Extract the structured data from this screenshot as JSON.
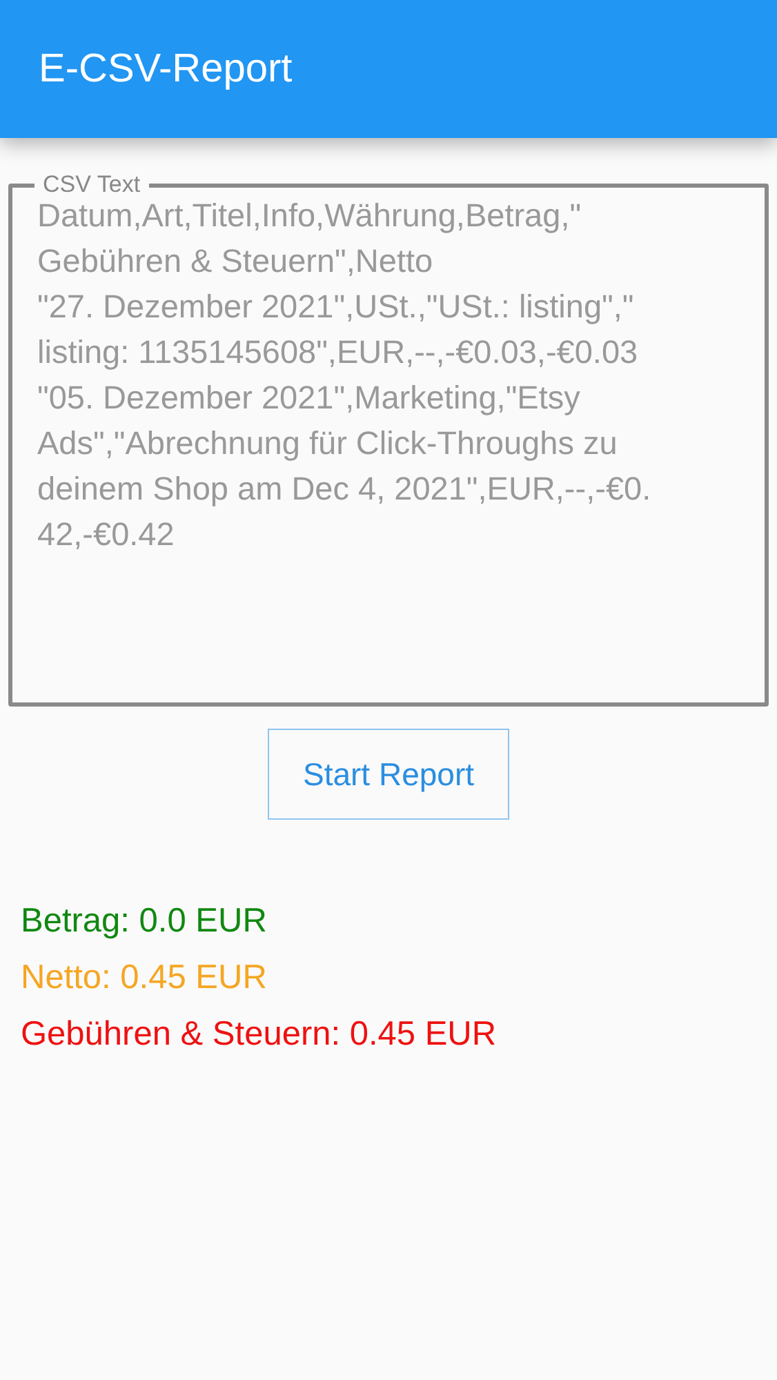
{
  "app_bar": {
    "title": "E-CSV-Report"
  },
  "csv_field": {
    "label": "CSV Text",
    "value_lines": [
      "Datum,Art,Titel,Info,Währung,Betrag,\"",
      "Gebühren & Steuern\",Netto",
      "\"27. Dezember 2021\",USt.,\"USt.: listing\",\"",
      "listing: 1135145608\",EUR,--,-€0.03,-€0.03",
      "\"05. Dezember 2021\",Marketing,\"Etsy",
      "Ads\",\"Abrechnung für Click-Throughs zu",
      "deinem Shop am Dec 4, 2021\",EUR,--,-€0.",
      "42,-€0.42"
    ]
  },
  "button": {
    "label": "Start Report"
  },
  "results": [
    {
      "text": "Betrag: 0.0 EUR",
      "color": "#118811"
    },
    {
      "text": "Netto: 0.45 EUR",
      "color": "#f5a623"
    },
    {
      "text": "Gebühren & Steuern: 0.45 EUR",
      "color": "#ee1111"
    }
  ]
}
